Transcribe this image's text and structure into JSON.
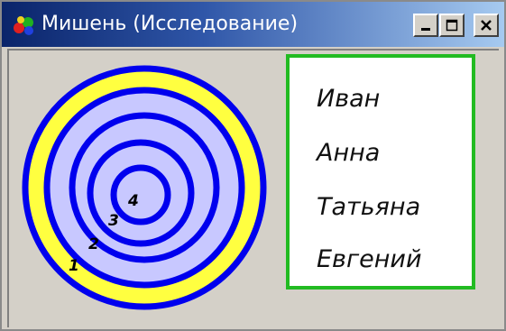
{
  "window": {
    "title": "Мишень (Исследование)"
  },
  "colors": {
    "ring_outer": "#ffff40",
    "ring_inner": "#c8c8ff",
    "ring_border": "#0000ee",
    "list_border": "#22bb22"
  },
  "target": {
    "ring_labels": [
      "1",
      "2",
      "3",
      "4"
    ]
  },
  "names": [
    "Иван",
    "Анна",
    "Татьяна",
    "Евгений"
  ]
}
